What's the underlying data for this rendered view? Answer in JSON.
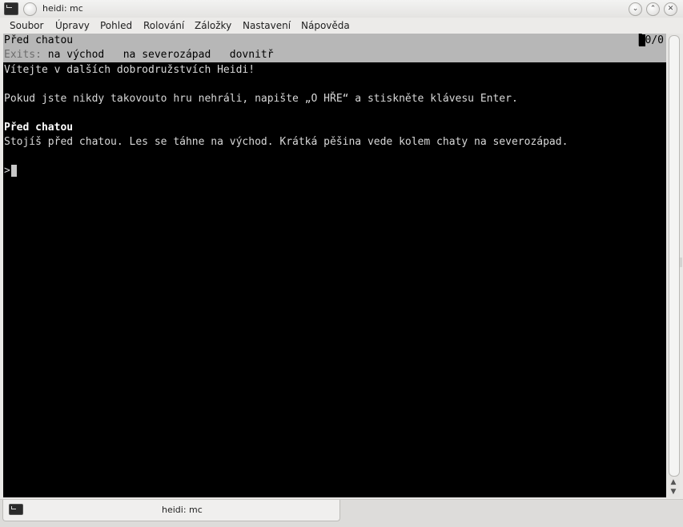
{
  "window": {
    "title": "heidi: mc",
    "controls": {
      "minimize": "⌄",
      "maximize": "⌃",
      "close": "✕"
    }
  },
  "menu": [
    "Soubor",
    "Úpravy",
    "Pohled",
    "Rolování",
    "Záložky",
    "Nastavení",
    "Nápověda"
  ],
  "terminal": {
    "status_location": "Před chatou",
    "status_count": "0/0",
    "exits_label": "Exits:",
    "exits": "na východ   na severozápad   dovnitř",
    "lines": [
      "Vítejte v dalších dobrodružstvích Heidi!",
      "",
      "Pokud jste nikdy takovouto hru nehráli, napište „O HŘE“ a stiskněte klávesu Enter.",
      "",
      "Před chatou",
      "Stojíš před chatou. Les se táhne na východ. Krátká pěšina vede kolem chaty na severozápad.",
      "",
      ">"
    ]
  },
  "tab": {
    "label": "heidi: mc"
  },
  "colors": {
    "terminal_bg": "#000000",
    "terminal_fg": "#d8d8d8",
    "status_bg": "#b7b7b7",
    "chrome_bg": "#e9e8e6"
  }
}
